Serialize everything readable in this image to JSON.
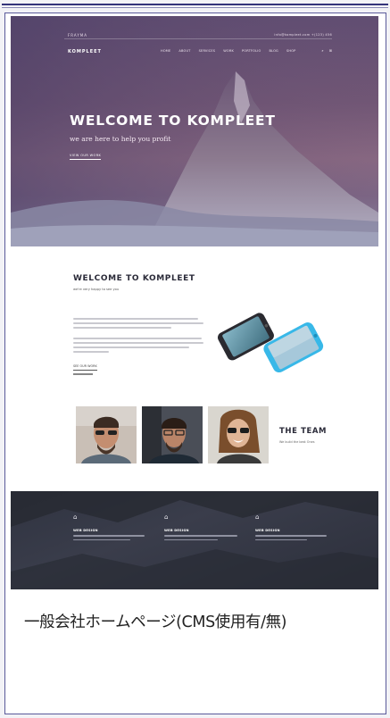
{
  "site": {
    "top_label": "FRAYMA",
    "header_contact": "info@kompleet.com  +(123) 456",
    "brand": "KOMPLEET",
    "nav": [
      "HOME",
      "ABOUT",
      "SERVICES",
      "WORK",
      "PORTFOLIO",
      "BLOG",
      "SHOP"
    ],
    "nav_icons": [
      "search-icon",
      "cart-icon"
    ],
    "nav_icon_glyphs": [
      "⌕",
      "⊞"
    ]
  },
  "hero": {
    "title": "WELCOME TO KOMPLEET",
    "subtitle": "we are here to help you profit",
    "button": "VIEW OUR WORK"
  },
  "welcome": {
    "title": "WELCOME TO KOMPLEET",
    "subtitle": "we're very happy to see you",
    "button": "SEE OUR WORK"
  },
  "team": {
    "title": "THE TEAM",
    "subtitle": "We build the best Ones"
  },
  "features": [
    {
      "icon": "briefcase-icon",
      "glyph": "⌂",
      "title": "WEB DESIGN"
    },
    {
      "icon": "briefcase-icon",
      "glyph": "⌂",
      "title": "WEB DESIGN"
    },
    {
      "icon": "briefcase-icon",
      "glyph": "⌂",
      "title": "WEB DESIGN"
    }
  ],
  "caption": "一般会社ホームページ(CMS使用有/無)",
  "colors": {
    "frame": "#5a5a9a",
    "hero_top": "#5a4a70",
    "hero_bottom": "#8c8ea8",
    "features_bg": "#2f3340",
    "phone_accent": "#38b8e8"
  }
}
